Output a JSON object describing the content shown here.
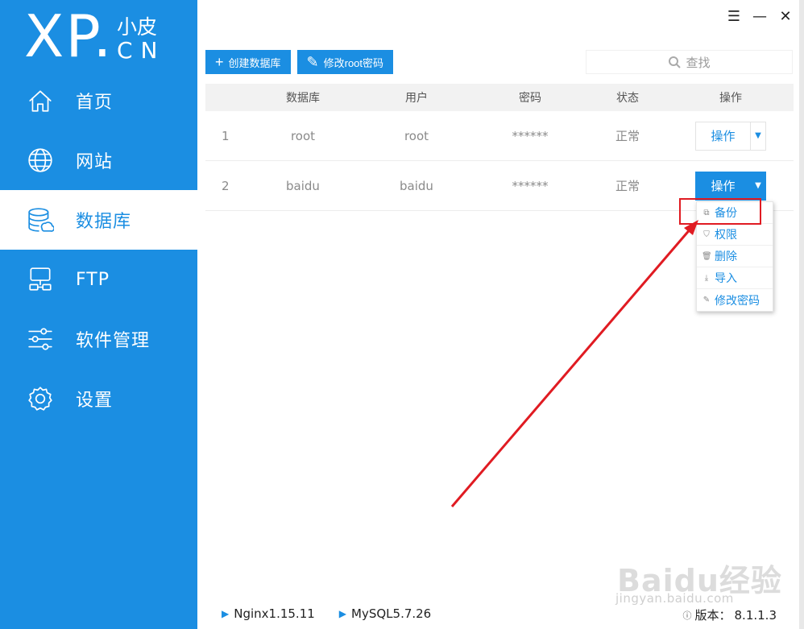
{
  "brand": {
    "xp": "XP.",
    "cn_top": "小皮",
    "cn_bottom": "CN"
  },
  "nav": [
    {
      "label": "首页",
      "icon": "home-icon"
    },
    {
      "label": "网站",
      "icon": "globe-icon"
    },
    {
      "label": "数据库",
      "icon": "database-icon",
      "active": true
    },
    {
      "label": "FTP",
      "icon": "ftp-icon"
    },
    {
      "label": "软件管理",
      "icon": "sliders-icon"
    },
    {
      "label": "设置",
      "icon": "gear-icon"
    }
  ],
  "window": {
    "menu": "☰",
    "minimize": "—",
    "close": "✕"
  },
  "toolbar": {
    "create_label": "创建数据库",
    "modify_root_label": "修改root密码"
  },
  "search": {
    "placeholder": "查找"
  },
  "table": {
    "headers": [
      "",
      "数据库",
      "用户",
      "密码",
      "状态",
      "操作"
    ],
    "rows": [
      {
        "index": "1",
        "database": "root",
        "user": "root",
        "password": "******",
        "status": "正常",
        "action": "操作"
      },
      {
        "index": "2",
        "database": "baidu",
        "user": "baidu",
        "password": "******",
        "status": "正常",
        "action": "操作"
      }
    ]
  },
  "dropdown": {
    "items": [
      {
        "label": "备份",
        "icon": "copy-icon"
      },
      {
        "label": "权限",
        "icon": "shield-icon"
      },
      {
        "label": "删除",
        "icon": "trash-icon"
      },
      {
        "label": "导入",
        "icon": "import-icon"
      },
      {
        "label": "修改密码",
        "icon": "pencil-icon"
      }
    ]
  },
  "statusbar": {
    "nginx": "Nginx1.15.11",
    "mysql": "MySQL5.7.26",
    "version_label": "版本：",
    "version": "8.1.1.3"
  },
  "watermark": {
    "brand": "Baidu经验",
    "url": "jingyan.baidu.com"
  },
  "colors": {
    "primary": "#1b8ee2",
    "highlight": "#e01b22"
  }
}
